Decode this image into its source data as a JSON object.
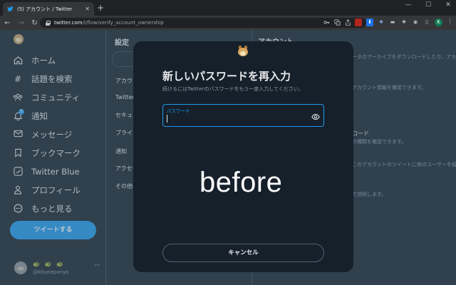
{
  "browser": {
    "tab": {
      "title": "(5) アカウント / Twitter",
      "close": "✕",
      "favicon": "twitter-bird-icon"
    },
    "new_tab": "+",
    "window_controls": {
      "minimize": "—",
      "maximize": "☐",
      "close": "✕"
    },
    "nav": {
      "back": "←",
      "forward": "→",
      "reload": "↻"
    },
    "url": {
      "host": "twitter.com",
      "path": "/i/flow/verify_account_ownership"
    },
    "omnibox_icons": [
      "key-icon",
      "translate-icon",
      "share-icon",
      "bookmark-star-icon"
    ],
    "extensions": [
      "extension-red-icon",
      "download-icon",
      "dropbox-icon",
      "folder-icon",
      "puzzle-icon",
      "camera-icon",
      "sidepanel-icon"
    ],
    "profile_initial": "K",
    "menu": "⋮"
  },
  "nav": {
    "items": [
      {
        "label": "ホーム",
        "icon": "home-icon"
      },
      {
        "label": "話題を検索",
        "icon": "hashtag-icon"
      },
      {
        "label": "コミュニティ",
        "icon": "communities-icon"
      },
      {
        "label": "通知",
        "icon": "bell-icon",
        "badge": "5"
      },
      {
        "label": "メッセージ",
        "icon": "mail-icon"
      },
      {
        "label": "ブックマーク",
        "icon": "bookmark-icon"
      },
      {
        "label": "Twitter Blue",
        "icon": "twitter-blue-icon"
      },
      {
        "label": "プロフィール",
        "icon": "person-icon"
      },
      {
        "label": "もっと見る",
        "icon": "more-circle-icon"
      }
    ],
    "tweet_button": "ツイートする",
    "account": {
      "name": "🐢 🐢 🐢",
      "handle": "@kituneponyo",
      "more": "···"
    }
  },
  "settings": {
    "title": "設定",
    "items": [
      "アカウ",
      "Twitter",
      "セキュリ",
      "プライバ",
      "通知",
      "アクセシ",
      "その他の"
    ]
  },
  "account_panel": {
    "title": "アカウント",
    "lines": [
      {
        "type": "text",
        "text": "ータのアーカイブをダウンロードしたり、アカ"
      },
      {
        "type": "text",
        "text": "アカウント情報を確認できます。"
      },
      {
        "type": "text",
        "text": "。"
      },
      {
        "type": "head",
        "text": "ロード"
      },
      {
        "type": "text",
        "text": "の種類を確認できます。"
      },
      {
        "type": "text",
        "text": "このアカウントのツイートに他のユーザーを紹"
      },
      {
        "type": "text",
        "text": "て説明します。"
      }
    ]
  },
  "modal": {
    "title": "新しいパスワードを再入力",
    "subtitle": "続けるにはTwitterのパスワードをもう一度入力してください。",
    "password_label": "パスワード",
    "password_value": "",
    "overlay_label": "before",
    "cancel": "キャンセル"
  },
  "colors": {
    "accent": "#1d9bf0",
    "background": "#15202b",
    "text": "#e7e9ea",
    "muted": "#8b98a5"
  }
}
